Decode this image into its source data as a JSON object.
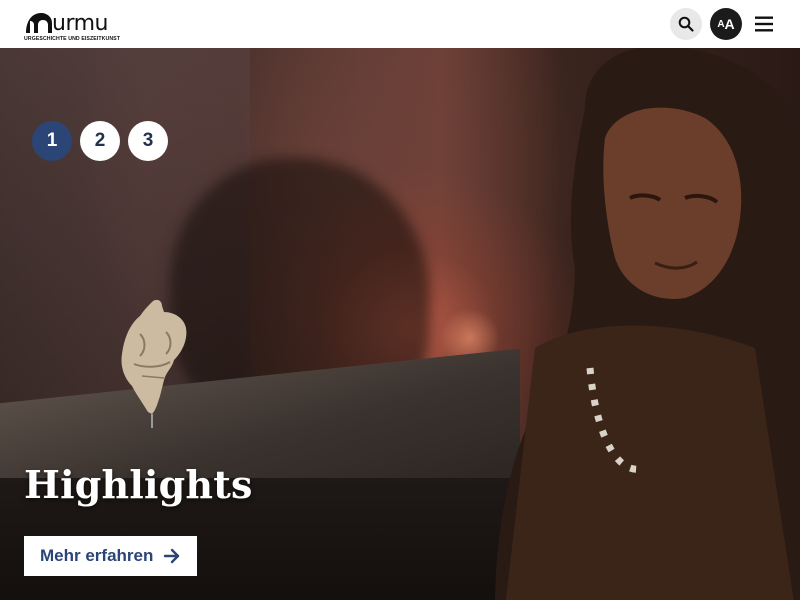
{
  "header": {
    "logo_word": "urmu",
    "logo_subtitle": "URGESCHICHTE UND EISZEITKUNST",
    "search_icon": "search-icon",
    "text_size_small": "A",
    "text_size_big": "A",
    "menu_icon": "hamburger-menu-icon"
  },
  "hero": {
    "pager": [
      {
        "label": "1",
        "active": true
      },
      {
        "label": "2",
        "active": false
      },
      {
        "label": "3",
        "active": false
      }
    ],
    "title": "Highlights",
    "cta_label": "Mehr erfahren",
    "cta_icon": "arrow-right-icon"
  },
  "colors": {
    "brand_blue": "#2b4576",
    "header_bg": "#ffffff",
    "search_bg": "#e8e8e8",
    "dark_button": "#1b1b1b"
  }
}
